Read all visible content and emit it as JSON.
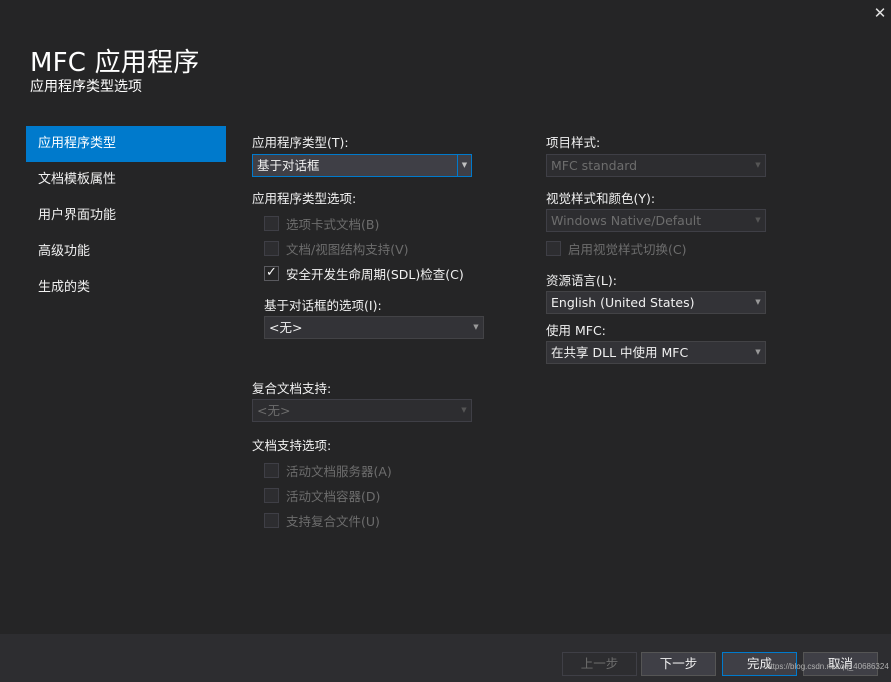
{
  "window": {
    "title": "MFC 应用程序",
    "subtitle": "应用程序类型选项",
    "close_glyph": "✕"
  },
  "sidebar": {
    "items": [
      {
        "label": "应用程序类型",
        "active": true
      },
      {
        "label": "文档模板属性",
        "active": false
      },
      {
        "label": "用户界面功能",
        "active": false
      },
      {
        "label": "高级功能",
        "active": false
      },
      {
        "label": "生成的类",
        "active": false
      }
    ]
  },
  "left": {
    "app_type_label": "应用程序类型(T):",
    "app_type_value": "基于对话框",
    "app_type_options_label": "应用程序类型选项:",
    "options": [
      {
        "label": "选项卡式文档(B)",
        "checked": false,
        "enabled": false
      },
      {
        "label": "文档/视图结构支持(V)",
        "checked": false,
        "enabled": false
      },
      {
        "label": "安全开发生命周期(SDL)检查(C)",
        "checked": true,
        "enabled": true
      }
    ],
    "dialog_options_label": "基于对话框的选项(I):",
    "dialog_options_value": "<无>",
    "compound_label": "复合文档支持:",
    "compound_value": "<无>",
    "doc_support_label": "文档支持选项:",
    "doc_options": [
      {
        "label": "活动文档服务器(A)",
        "checked": false,
        "enabled": false
      },
      {
        "label": "活动文档容器(D)",
        "checked": false,
        "enabled": false
      },
      {
        "label": "支持复合文件(U)",
        "checked": false,
        "enabled": false
      }
    ]
  },
  "right": {
    "project_style_label": "项目样式:",
    "project_style_value": "MFC standard",
    "visual_style_label": "视觉样式和颜色(Y):",
    "visual_style_value": "Windows Native/Default",
    "enable_visual_switch_label": "启用视觉样式切换(C)",
    "resource_lang_label": "资源语言(L):",
    "resource_lang_value": "English (United States)",
    "use_mfc_label": "使用 MFC:",
    "use_mfc_value": "在共享 DLL 中使用 MFC"
  },
  "footer": {
    "prev_label": "上一步",
    "next_label": "下一步",
    "finish_label": "完成",
    "cancel_label": "取消",
    "watermark": "https://blog.csdn.net/qq_40686324"
  },
  "colors": {
    "background": "#252526",
    "accent": "#007acc",
    "footer": "#2d2d30"
  },
  "icons": {
    "dropdown": "chevron-down-icon",
    "close": "close-icon",
    "check": "checkmark-icon"
  }
}
